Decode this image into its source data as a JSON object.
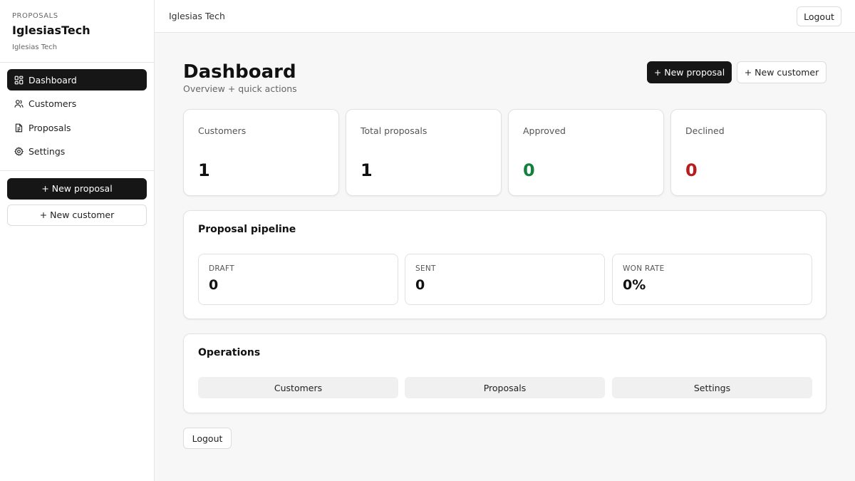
{
  "colors": {
    "primary": "#161616",
    "approved": "#15803d",
    "declined": "#b91c1c"
  },
  "sidebar": {
    "eyebrow": "PROPOSALS",
    "brand_name": "IglesiasTech",
    "brand_sub": "Iglesias Tech",
    "nav": [
      {
        "label": "Dashboard",
        "icon": "dashboard-icon",
        "active": true
      },
      {
        "label": "Customers",
        "icon": "users-icon",
        "active": false
      },
      {
        "label": "Proposals",
        "icon": "document-icon",
        "active": false
      },
      {
        "label": "Settings",
        "icon": "gear-icon",
        "active": false
      }
    ],
    "new_proposal_label": "+ New proposal",
    "new_customer_label": "+ New customer"
  },
  "topbar": {
    "title": "Iglesias Tech",
    "logout_label": "Logout"
  },
  "header": {
    "title": "Dashboard",
    "subtitle": "Overview + quick actions",
    "new_proposal_label": "+ New proposal",
    "new_customer_label": "+ New customer"
  },
  "stats": [
    {
      "label": "Customers",
      "value": "1"
    },
    {
      "label": "Total proposals",
      "value": "1"
    },
    {
      "label": "Approved",
      "value": "0"
    },
    {
      "label": "Declined",
      "value": "0"
    }
  ],
  "pipeline": {
    "title": "Proposal pipeline",
    "items": [
      {
        "label": "DRAFT",
        "value": "0"
      },
      {
        "label": "SENT",
        "value": "0"
      },
      {
        "label": "WON RATE",
        "value": "0%"
      }
    ]
  },
  "operations": {
    "title": "Operations",
    "buttons": [
      "Customers",
      "Proposals",
      "Settings"
    ]
  },
  "footer": {
    "logout_label": "Logout"
  }
}
